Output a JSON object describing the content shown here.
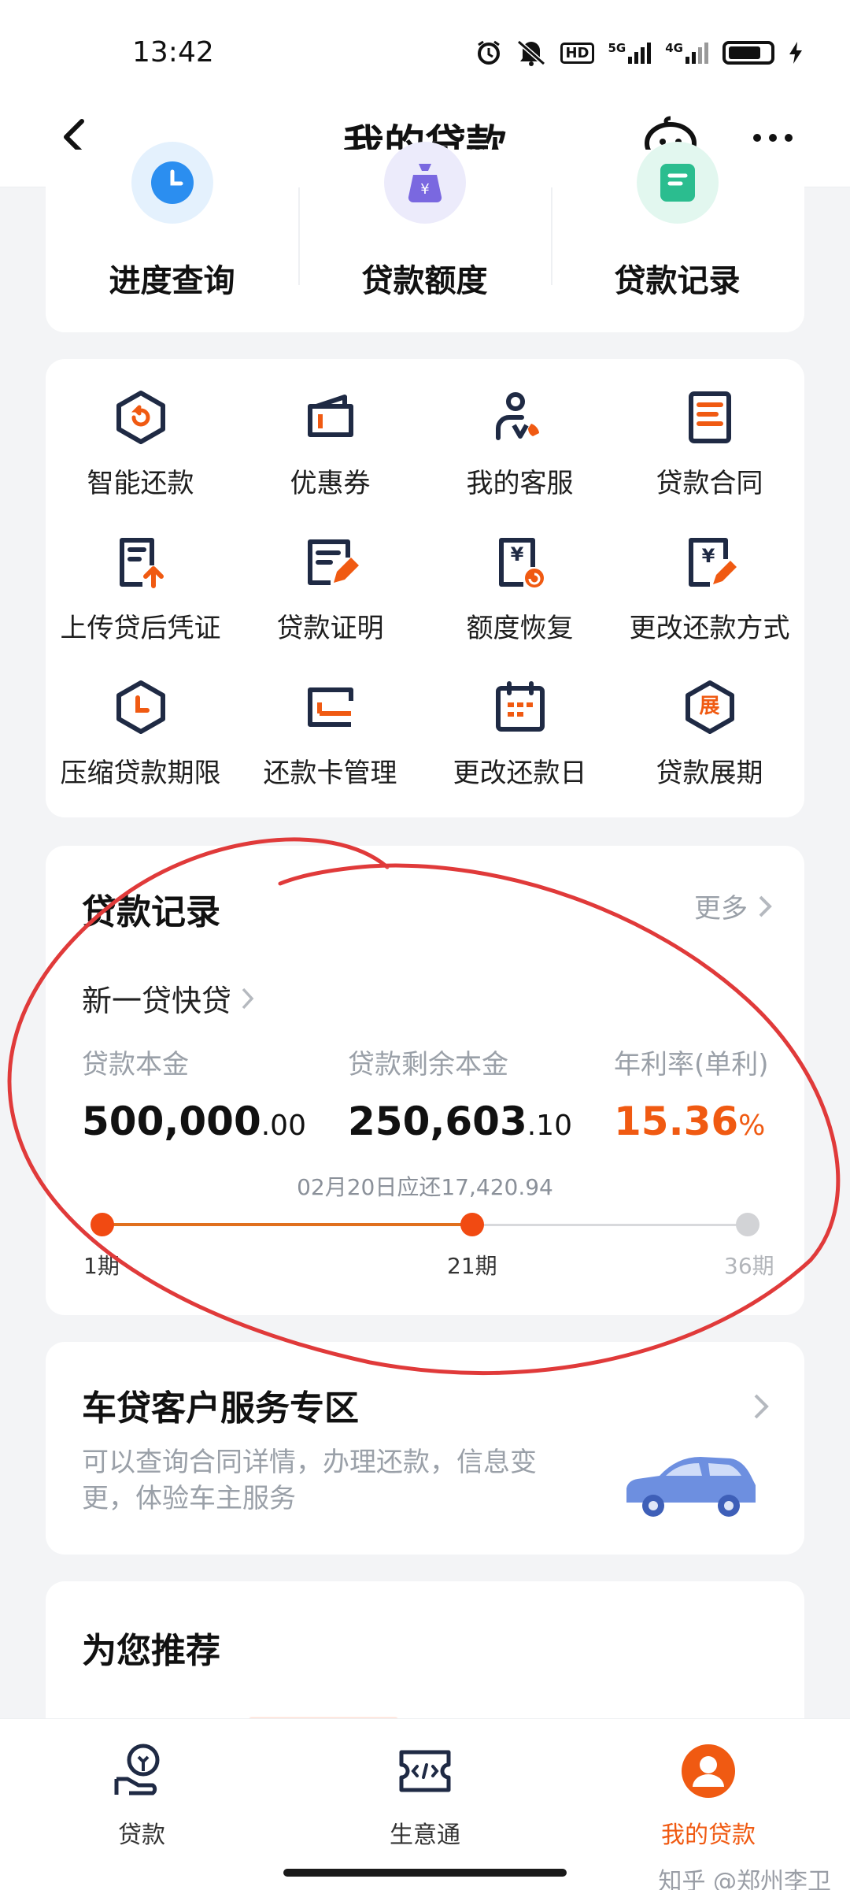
{
  "status_bar": {
    "time": "13:42",
    "network_1": "5G",
    "network_2": "4G",
    "hd": "HD"
  },
  "header": {
    "title": "我的贷款"
  },
  "quick_actions": [
    {
      "label": "进度查询",
      "icon": "clock-icon",
      "color": "#2b8ef0"
    },
    {
      "label": "贷款额度",
      "icon": "money-bag-icon",
      "color": "#7a68e0"
    },
    {
      "label": "贷款记录",
      "icon": "record-icon",
      "color": "#2bbd8f"
    }
  ],
  "services": [
    {
      "label": "智能还款",
      "icon": "smart-repay-icon"
    },
    {
      "label": "优惠券",
      "icon": "coupon-icon"
    },
    {
      "label": "我的客服",
      "icon": "customer-service-icon"
    },
    {
      "label": "贷款合同",
      "icon": "contract-icon"
    },
    {
      "label": "上传贷后凭证",
      "icon": "upload-voucher-icon"
    },
    {
      "label": "贷款证明",
      "icon": "loan-certificate-icon"
    },
    {
      "label": "额度恢复",
      "icon": "quota-restore-icon"
    },
    {
      "label": "更改还款方式",
      "icon": "change-repay-method-icon"
    },
    {
      "label": "压缩贷款期限",
      "icon": "compress-term-icon"
    },
    {
      "label": "还款卡管理",
      "icon": "card-manage-icon"
    },
    {
      "label": "更改还款日",
      "icon": "calendar-icon"
    },
    {
      "label": "贷款展期",
      "icon": "extension-icon",
      "badge": "展"
    }
  ],
  "loan_record": {
    "title": "贷款记录",
    "more": "更多",
    "product": "新一贷快贷",
    "principal_label": "贷款本金",
    "principal_int": "500,000",
    "principal_dec": ".00",
    "remaining_label": "贷款剩余本金",
    "remaining_int": "250,603",
    "remaining_dec": ".10",
    "rate_label": "年利率(单利)",
    "rate_value": "15.36",
    "rate_unit": "%",
    "due_text": "02月20日应还17,420.94",
    "periods": {
      "first": "1期",
      "current": "21期",
      "last": "36期"
    },
    "progress": {
      "current": 21,
      "total": 36
    }
  },
  "car_loan": {
    "title": "车贷客户服务专区",
    "desc": "可以查询合同详情，办理还款，信息变更，体验车主服务"
  },
  "recommend": {
    "title": "为您推荐"
  },
  "tabs": [
    {
      "label": "贷款",
      "icon": "loan-hand-icon",
      "active": false
    },
    {
      "label": "生意通",
      "icon": "ticket-icon",
      "active": false
    },
    {
      "label": "我的贷款",
      "icon": "user-icon",
      "active": true
    }
  ],
  "watermark": "知乎 @郑州李卫",
  "colors": {
    "accent": "#f05a12",
    "navy": "#1f2a44",
    "annotation": "#e03a3a"
  }
}
